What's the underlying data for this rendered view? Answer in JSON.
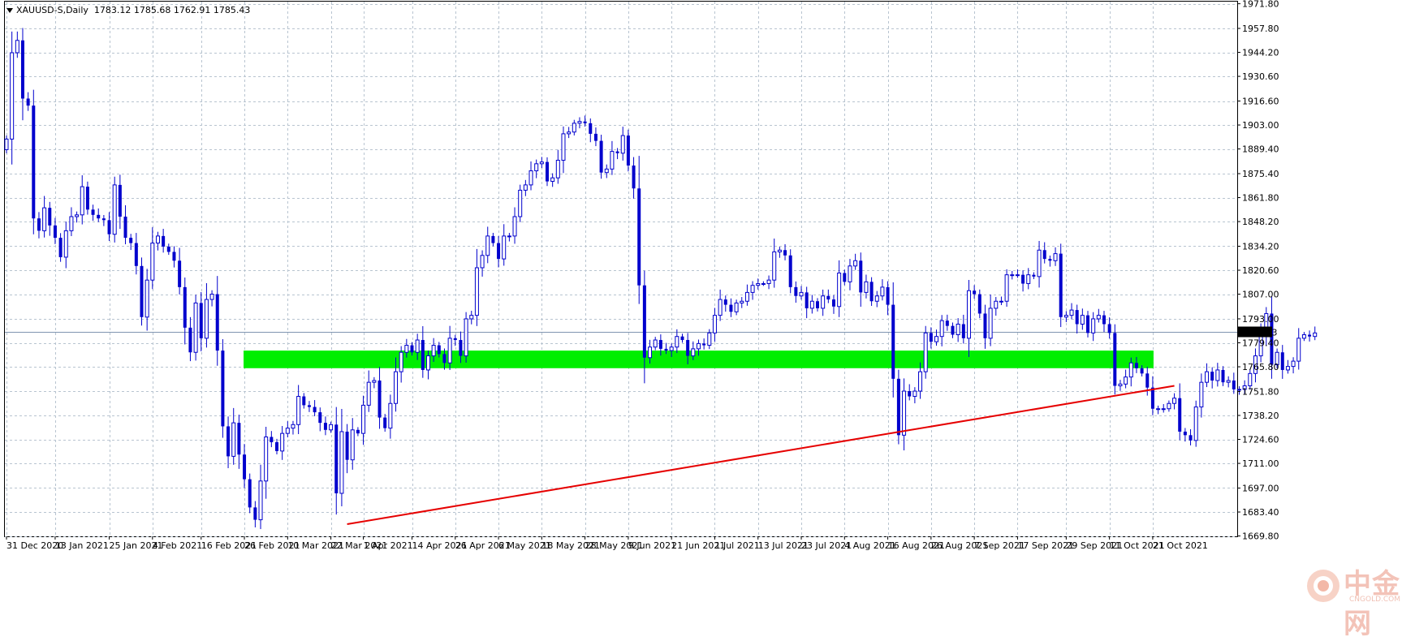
{
  "header": {
    "symbol": "XAUUSD-S,Daily",
    "ohlc": "1783.12 1785.68 1762.91 1785.43"
  },
  "price_tag": "1785.43",
  "watermark": {
    "text": "中金网",
    "sub": "CNGOLD.COM"
  },
  "colors": {
    "candle": "#0000cd",
    "zone": "#00ee00",
    "trendline": "#e60000",
    "grid": "#b8c4d0",
    "price_line": "#7f95b0"
  },
  "chart_data": {
    "type": "candlestick",
    "title": "",
    "ylim": [
      1669.6,
      1973.0
    ],
    "y_ticks": [
      1971.8,
      1957.8,
      1944.2,
      1930.6,
      1916.6,
      1903.0,
      1889.4,
      1875.4,
      1861.8,
      1848.2,
      1834.2,
      1820.6,
      1807.0,
      1793.0,
      1779.4,
      1765.8,
      1751.8,
      1738.2,
      1724.6,
      1711.0,
      1697.0,
      1683.4,
      1669.8
    ],
    "y_tick_labels": [
      "1971.80",
      "1957.80",
      "1944.20",
      "1930.60",
      "1916.60",
      "1903.00",
      "1889.40",
      "1875.40",
      "1861.80",
      "1848.20",
      "1834.20",
      "1820.60",
      "1807.00",
      "1793.00",
      "1779.40",
      "1765.80",
      "1751.80",
      "1738.20",
      "1724.60",
      "1711.00",
      "1697.00",
      "1683.40",
      "1669.80"
    ],
    "x_tick_labels": [
      "31 Dec 2020",
      "13 Jan 2021",
      "25 Jan 2021",
      "4 Feb 2021",
      "16 Feb 2021",
      "26 Feb 2021",
      "10 Mar 2021",
      "22 Mar 2021",
      "1 Apr 2021",
      "14 Apr 2021",
      "26 Apr 2021",
      "6 May 2021",
      "18 May 2021",
      "28 May 2021",
      "9 Jun 2021",
      "21 Jun 2021",
      "1 Jul 2021",
      "13 Jul 2021",
      "23 Jul 2021",
      "4 Aug 2021",
      "16 Aug 2021",
      "26 Aug 2021",
      "7 Sep 2021",
      "17 Sep 2021",
      "29 Sep 2021",
      "11 Oct 2021",
      "21 Oct 2021"
    ],
    "x_tick_bar_index": [
      0,
      9,
      19,
      27,
      36,
      44,
      52,
      60,
      66,
      75,
      83,
      91,
      99,
      107,
      115,
      123,
      131,
      139,
      147,
      155,
      163,
      171,
      179,
      187,
      196,
      204,
      212
    ],
    "current_price": 1785.43,
    "support_zone": {
      "low": 1765.0,
      "high": 1775.0
    },
    "trendline": {
      "from": {
        "bar": 63,
        "price": 1676.5
      },
      "to": {
        "bar": 216,
        "price": 1755.0
      }
    },
    "closes": [
      1895,
      1944,
      1951,
      1918,
      1914,
      1850,
      1843,
      1856,
      1846,
      1839,
      1828,
      1843,
      1851,
      1852,
      1868,
      1855,
      1852,
      1850,
      1849,
      1841,
      1869,
      1851,
      1839,
      1836,
      1823,
      1794,
      1815,
      1836,
      1840,
      1834,
      1831,
      1826,
      1811,
      1788,
      1774,
      1802,
      1782,
      1804,
      1807,
      1775,
      1732,
      1715,
      1734,
      1716,
      1702,
      1686,
      1679,
      1701,
      1726,
      1723,
      1718,
      1728,
      1731,
      1733,
      1749,
      1744,
      1743,
      1740,
      1734,
      1730,
      1733,
      1694,
      1729,
      1713,
      1730,
      1728,
      1744,
      1757,
      1758,
      1737,
      1731,
      1745,
      1763,
      1774,
      1778,
      1774,
      1781,
      1764,
      1772,
      1778,
      1773,
      1768,
      1782,
      1781,
      1772,
      1793,
      1795,
      1822,
      1829,
      1840,
      1836,
      1827,
      1840,
      1840,
      1851,
      1866,
      1869,
      1877,
      1881,
      1882,
      1871,
      1873,
      1883,
      1898,
      1899,
      1904,
      1905,
      1904,
      1898,
      1894,
      1876,
      1878,
      1888,
      1887,
      1897,
      1880,
      1867,
      1812,
      1771,
      1777,
      1781,
      1776,
      1775,
      1777,
      1783,
      1781,
      1772,
      1776,
      1779,
      1778,
      1785,
      1795,
      1804,
      1801,
      1797,
      1802,
      1803,
      1808,
      1812,
      1813,
      1813,
      1815,
      1831,
      1832,
      1829,
      1811,
      1806,
      1808,
      1799,
      1803,
      1799,
      1806,
      1804,
      1800,
      1819,
      1814,
      1823,
      1826,
      1808,
      1814,
      1803,
      1806,
      1811,
      1801,
      1759,
      1727,
      1752,
      1749,
      1752,
      1763,
      1785,
      1780,
      1783,
      1792,
      1789,
      1784,
      1790,
      1782,
      1809,
      1807,
      1796,
      1782,
      1799,
      1803,
      1803,
      1818,
      1818,
      1818,
      1813,
      1818,
      1817,
      1832,
      1827,
      1826,
      1830,
      1794,
      1795,
      1798,
      1790,
      1795,
      1785,
      1793,
      1795,
      1790,
      1785,
      1755,
      1756,
      1760,
      1768,
      1765,
      1762,
      1754,
      1742,
      1742,
      1742,
      1745,
      1748,
      1729,
      1727,
      1724,
      1743,
      1757,
      1763,
      1758,
      1764,
      1757,
      1758,
      1753,
      1753,
      1755,
      1762,
      1772,
      1784,
      1796,
      1767,
      1774,
      1764,
      1766,
      1769,
      1782,
      1784,
      1783,
      1785
    ]
  }
}
